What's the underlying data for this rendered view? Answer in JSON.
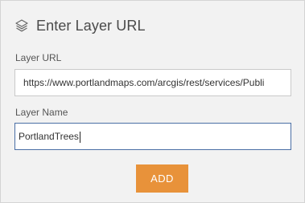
{
  "header": {
    "icon": "layers-icon",
    "title": "Enter Layer URL"
  },
  "form": {
    "url_label": "Layer URL",
    "url_value": "https://www.portlandmaps.com/arcgis/rest/services/Publi",
    "name_label": "Layer Name",
    "name_value": "PortlandTrees"
  },
  "actions": {
    "add_label": "ADD"
  },
  "colors": {
    "panel_bg": "#f2f2f2",
    "accent_button": "#e8923a",
    "focus_border": "#4a6fa5"
  }
}
